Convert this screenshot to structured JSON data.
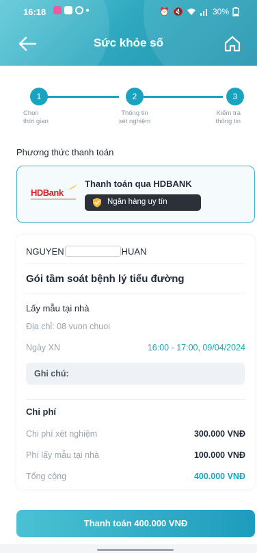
{
  "status_bar": {
    "time": "16:18",
    "battery": "30%"
  },
  "header": {
    "title": "Sức khỏe số",
    "back_icon": "arrow-left-icon",
    "home_icon": "home-icon"
  },
  "stepper": {
    "steps": [
      {
        "number": "1",
        "label": "Chọn\nthời gian"
      },
      {
        "number": "2",
        "label": "Thông tin\nxét nghiệm"
      },
      {
        "number": "3",
        "label": "Kiểm tra\nthông tin"
      }
    ]
  },
  "payment_method": {
    "section_title": "Phương thức thanh toán",
    "bank_logo_text": "HDBank",
    "option_label": "Thanh toán qua HDBANK",
    "badge": "Ngân hàng uy tín"
  },
  "details": {
    "name_prefix": "NGUYEN",
    "name_suffix": "HUAN",
    "package_name": "Gói tầm soát bệnh lý tiểu đường",
    "collection_type": "Lấy mẫu tại nhà",
    "address": "Địa chỉ: 08 vuon chuoi",
    "date_label": "Ngày XN",
    "date_value": "16:00 - 17:00, 09/04/2024",
    "note_label": "Ghi chú:"
  },
  "costs": {
    "title": "Chi phí",
    "items": [
      {
        "label": "Chi phí xét nghiệm",
        "value": "300.000 VNĐ"
      },
      {
        "label": "Phí lấy mẫu tại nhà",
        "value": "100.000 VNĐ"
      },
      {
        "label": "Tổng cộng",
        "value": "400.000 VNĐ"
      }
    ]
  },
  "actions": {
    "pay_button": "Thanh toán 400.000 VNĐ"
  },
  "colors": {
    "accent": "#1aa3bf",
    "header_gradient_start": "#5cc8d8",
    "header_gradient_end": "#1e93ad",
    "brand_red": "#d4202a",
    "badge_bg": "#2b3039"
  }
}
